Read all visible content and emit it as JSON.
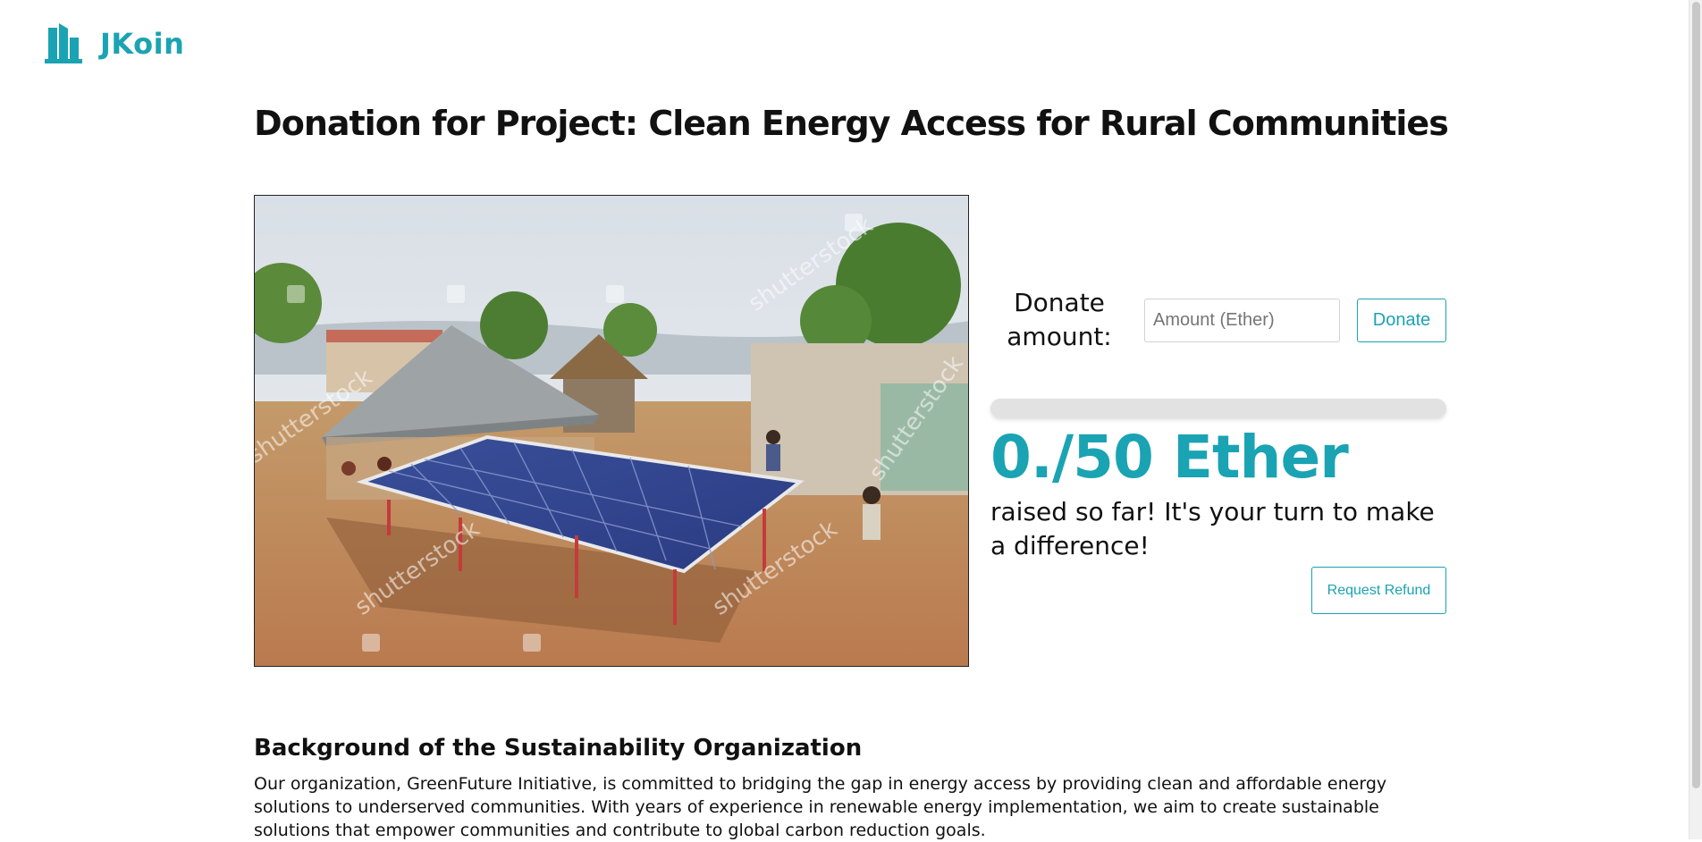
{
  "brand": {
    "name": "JKoin",
    "icon": "building-icon",
    "color": "#1aa3b3"
  },
  "project": {
    "title": "Donation for Project: Clean Energy Access for Rural Communities",
    "image": {
      "subject": "solar-panel-photo",
      "watermark": "shutterstock"
    }
  },
  "donation": {
    "label": "Donate amount:",
    "input_value": "",
    "input_placeholder": "Amount (Ether)",
    "donate_button_label": "Donate",
    "progress_fraction": 0,
    "raised_display": "0./50 Ether",
    "raised_text": "raised so far! It's your turn to make a difference!",
    "refund_button_label": "Request Refund"
  },
  "background": {
    "heading": "Background of the Sustainability Organization",
    "body": "Our organization, GreenFuture Initiative, is committed to bridging the gap in energy access by providing clean and affordable energy solutions to underserved communities. With years of experience in renewable energy implementation, we aim to create sustainable solutions that empower communities and contribute to global carbon reduction goals."
  },
  "colors": {
    "accent": "#1aa3b3",
    "progress_track": "#e2e2e2",
    "text": "#111111"
  }
}
